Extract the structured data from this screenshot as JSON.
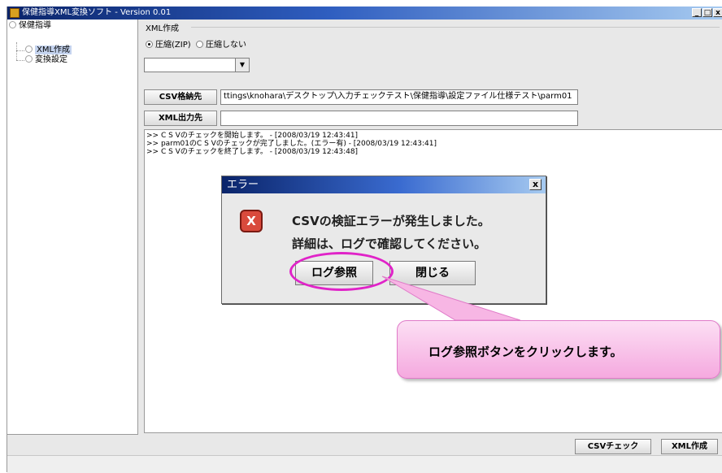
{
  "window": {
    "title": "保健指導XML変換ソフト - Version 0.01",
    "buttons": [
      "_",
      "□",
      "x"
    ]
  },
  "tree": {
    "root": "保健指導",
    "items": [
      "XML作成",
      "変換設定"
    ],
    "selected": "XML作成"
  },
  "main": {
    "group_title": "XML作成",
    "radio_zip": "圧縮(ZIP)",
    "radio_nozip": "圧縮しない",
    "csv_button": "CSV格納先",
    "csv_path": "ttings\\knohara\\デスクトップ\\入力チェックテスト\\保健指導\\設定ファイル仕様テスト\\parm01",
    "xml_button": "XML出力先",
    "xml_path": "",
    "log_lines": [
      ">> C S Vのチェックを開始します。 - [2008/03/19 12:43:41]",
      ">> parm01のC S Vのチェックが完了しました。(エラー有) - [2008/03/19 12:43:41]",
      ">> C S Vのチェックを終了します。 - [2008/03/19 12:43:48]"
    ]
  },
  "bottom": {
    "csv_check": "CSVチェック",
    "xml_create": "XML作成"
  },
  "dialog": {
    "title": "エラー",
    "close": "x",
    "message1": "CSVの検証エラーが発生しました。",
    "message2": "詳細は、ログで確認してください。",
    "log_button": "ログ参照",
    "close_button": "閉じる"
  },
  "callout": {
    "text": "ログ参照ボタンをクリックします。"
  },
  "colors": {
    "titlebar_start": "#0a246a",
    "titlebar_end": "#a6caf0",
    "error_icon": "#d94a3c",
    "highlight": "#e023c8",
    "callout_fill": "#f5a9df"
  }
}
